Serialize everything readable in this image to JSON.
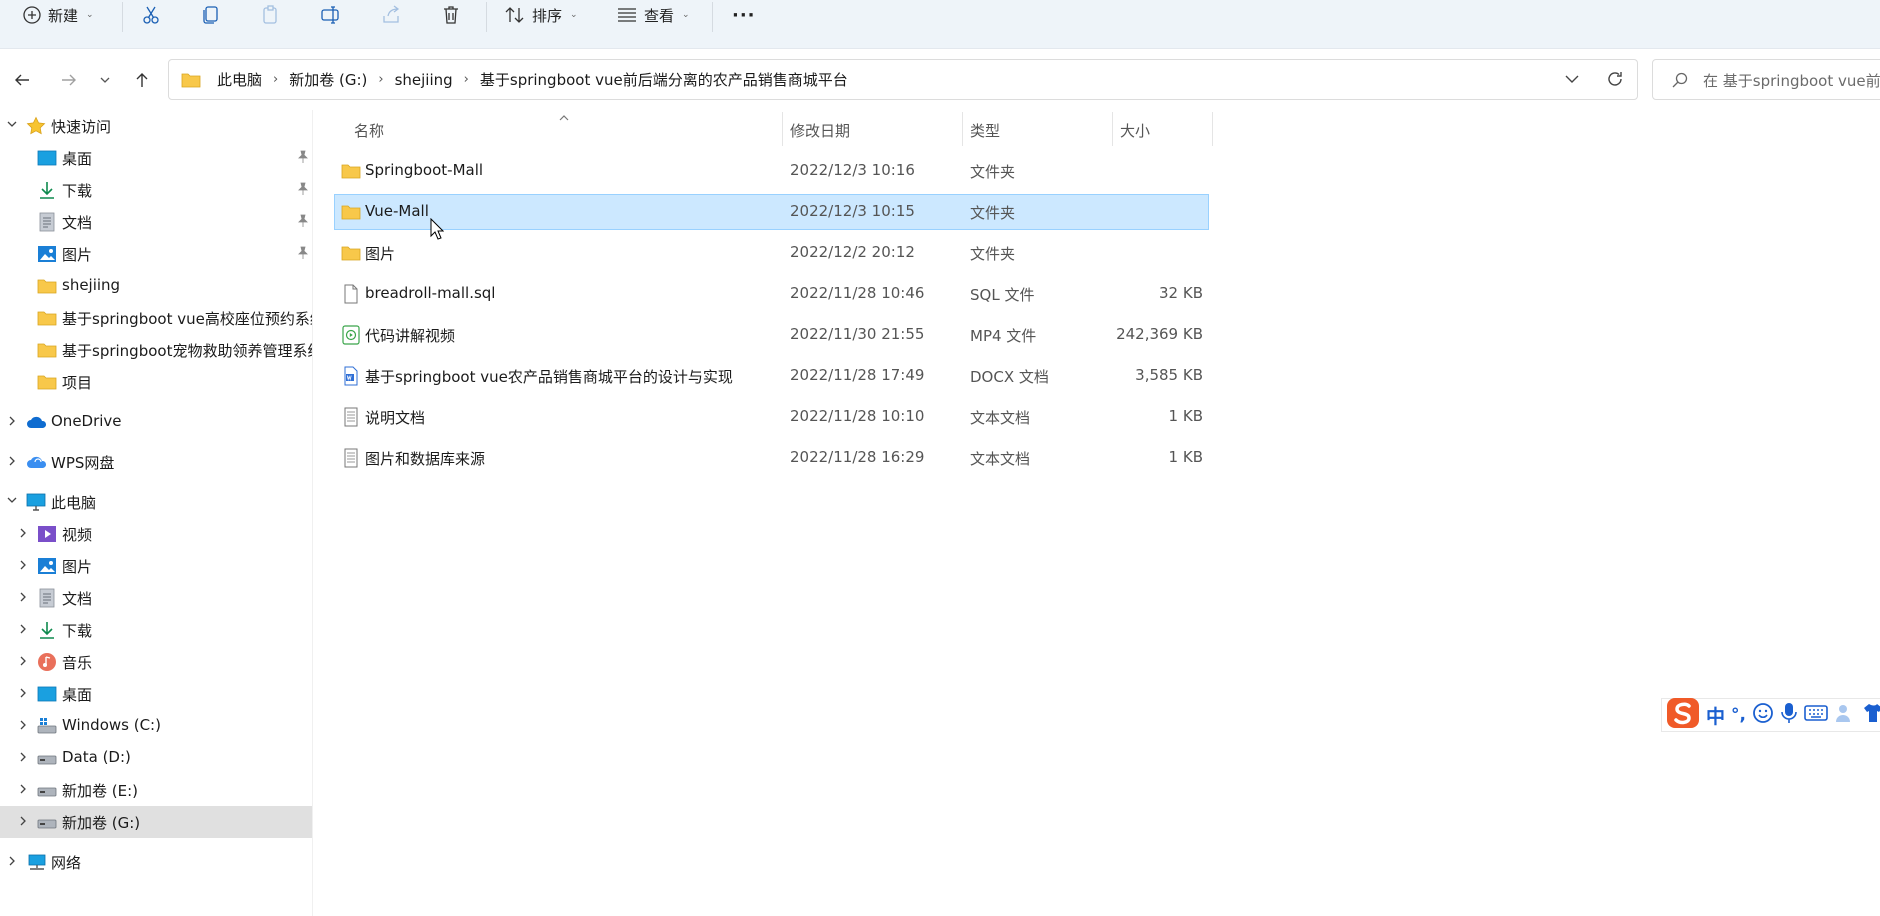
{
  "toolbar": {
    "new_label": "新建",
    "sort_label": "排序",
    "view_label": "查看",
    "more_label": "···"
  },
  "address": {
    "crumbs": [
      "此电脑",
      "新加卷 (G:)",
      "shejiing",
      "基于springboot vue前后端分离的农产品销售商城平台"
    ]
  },
  "search": {
    "placeholder": "在 基于springboot vue前后"
  },
  "sidebar": {
    "quick_access": "快速访问",
    "quick_items": [
      "桌面",
      "下载",
      "文档",
      "图片",
      "shejiing",
      "基于springboot vue高校座位预约系统",
      "基于springboot宠物救助领养管理系统",
      "项目"
    ],
    "onedrive": "OneDrive",
    "wps": "WPS网盘",
    "this_pc": "此电脑",
    "pc_items": [
      "视频",
      "图片",
      "文档",
      "下载",
      "音乐",
      "桌面",
      "Windows (C:)",
      "Data (D:)",
      "新加卷 (E:)",
      "新加卷 (G:)"
    ],
    "network": "网络"
  },
  "columns": {
    "name": "名称",
    "date": "修改日期",
    "type": "类型",
    "size": "大小"
  },
  "files": [
    {
      "name": "Springboot-Mall",
      "date": "2022/12/3 10:16",
      "type": "文件夹",
      "size": "",
      "icon": "folder-icon"
    },
    {
      "name": "Vue-Mall",
      "date": "2022/12/3 10:15",
      "type": "文件夹",
      "size": "",
      "icon": "folder-icon"
    },
    {
      "name": "图片",
      "date": "2022/12/2 20:12",
      "type": "文件夹",
      "size": "",
      "icon": "folder-icon"
    },
    {
      "name": "breadroll-mall.sql",
      "date": "2022/11/28 10:46",
      "type": "SQL 文件",
      "size": "32 KB",
      "icon": "file-icon"
    },
    {
      "name": "代码讲解视频",
      "date": "2022/11/30 21:55",
      "type": "MP4 文件",
      "size": "242,369 KB",
      "icon": "video-file-icon"
    },
    {
      "name": "基于springboot vue农产品销售商城平台的设计与实现",
      "date": "2022/11/28 17:49",
      "type": "DOCX 文档",
      "size": "3,585 KB",
      "icon": "word-doc-icon"
    },
    {
      "name": "说明文档",
      "date": "2022/11/28 10:10",
      "type": "文本文档",
      "size": "1 KB",
      "icon": "text-file-icon"
    },
    {
      "name": "图片和数据库来源",
      "date": "2022/11/28 16:29",
      "type": "文本文档",
      "size": "1 KB",
      "icon": "text-file-icon"
    }
  ],
  "ime": {
    "mode": "中",
    "punct": "°,"
  },
  "colors": {
    "accent": "#0067c0",
    "selection": "#cce8ff",
    "folder": "#f8c84a"
  }
}
